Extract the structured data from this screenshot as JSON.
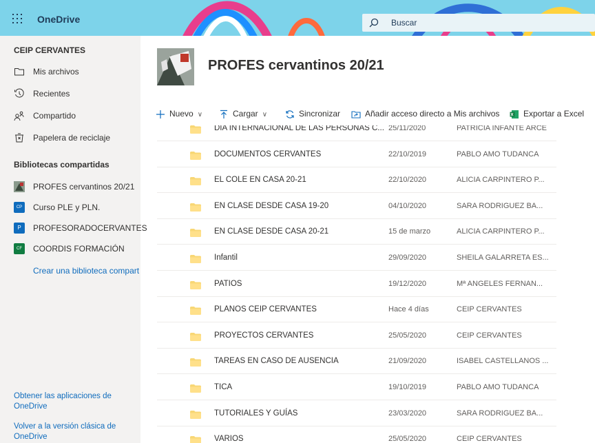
{
  "topbar": {
    "app_name": "OneDrive",
    "search_placeholder": "Buscar",
    "accent": "#7dd3ea"
  },
  "sidebar": {
    "owner": "CEIP CERVANTES",
    "nav": [
      {
        "label": "Mis archivos",
        "icon": "folder-icon"
      },
      {
        "label": "Recientes",
        "icon": "clock-icon"
      },
      {
        "label": "Compartido",
        "icon": "people-icon"
      },
      {
        "label": "Papelera de reciclaje",
        "icon": "trash-icon"
      }
    ],
    "shared_heading": "Bibliotecas compartidas",
    "libraries": [
      {
        "label": "PROFES cervantinos 20/21",
        "badge": "",
        "color": "#6b7a6e"
      },
      {
        "label": "Curso PLE y PLN.",
        "badge": "CP",
        "color": "#0f6cbd"
      },
      {
        "label": "PROFESORADOCERVANTES",
        "badge": "P",
        "color": "#0f6cbd"
      },
      {
        "label": "COORDIS FORMACIÓN",
        "badge": "CF",
        "color": "#107c41"
      }
    ],
    "create_library": "Crear una biblioteca compart",
    "get_apps": "Obtener las aplicaciones de OneDrive",
    "classic_view": "Volver a la versión clásica de OneDrive"
  },
  "header": {
    "title": "PROFES cervantinos 20/21"
  },
  "toolbar": {
    "new": "Nuevo",
    "upload": "Cargar",
    "sync": "Sincronizar",
    "add_shortcut": "Añadir acceso directo a Mis archivos",
    "export_excel": "Exportar a Excel"
  },
  "files": [
    {
      "name": "DIA INTERNACIONAL DE LAS PERSONAS C...",
      "date": "25/11/2020",
      "owner": "PATRICIA INFANTE ARCE"
    },
    {
      "name": "DOCUMENTOS CERVANTES",
      "date": "22/10/2019",
      "owner": "PABLO AMO TUDANCA"
    },
    {
      "name": "EL COLE EN CASA 20-21",
      "date": "22/10/2020",
      "owner": "ALICIA CARPINTERO P..."
    },
    {
      "name": "EN CLASE DESDE CASA 19-20",
      "date": "04/10/2020",
      "owner": "SARA RODRIGUEZ BA..."
    },
    {
      "name": "EN CLASE DESDE CASA 20-21",
      "date": "15 de marzo",
      "owner": "ALICIA CARPINTERO P..."
    },
    {
      "name": "Infantil",
      "date": "29/09/2020",
      "owner": "SHEILA GALARRETA ES..."
    },
    {
      "name": "PATIOS",
      "date": "19/12/2020",
      "owner": "Mª ANGELES FERNAN..."
    },
    {
      "name": "PLANOS CEIP CERVANTES",
      "date": "Hace 4 días",
      "owner": "CEIP CERVANTES"
    },
    {
      "name": "PROYECTOS CERVANTES",
      "date": "25/05/2020",
      "owner": "CEIP CERVANTES"
    },
    {
      "name": "TAREAS EN CASO DE AUSENCIA",
      "date": "21/09/2020",
      "owner": "ISABEL CASTELLANOS ..."
    },
    {
      "name": "TICA",
      "date": "19/10/2019",
      "owner": "PABLO AMO TUDANCA"
    },
    {
      "name": "TUTORIALES Y GUÍAS",
      "date": "23/03/2020",
      "owner": "SARA RODRIGUEZ BA..."
    },
    {
      "name": "VARIOS",
      "date": "25/05/2020",
      "owner": "CEIP CERVANTES"
    }
  ],
  "colors": {
    "folder": "#f8d775",
    "link": "#0f6cbd",
    "sidebar_bg": "#f3f2f1"
  }
}
